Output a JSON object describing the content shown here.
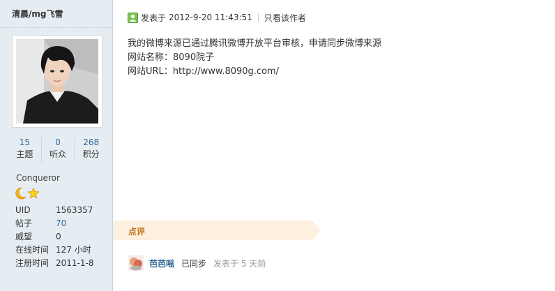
{
  "profile": {
    "username": "清晨/mg飞雪",
    "stats": [
      {
        "value": "15",
        "label": "主题"
      },
      {
        "value": "0",
        "label": "听众"
      },
      {
        "value": "268",
        "label": "积分"
      }
    ],
    "browser": "Conqueror",
    "info": [
      {
        "key": "UID",
        "value": "1563357"
      },
      {
        "key": "帖子",
        "value": "70"
      },
      {
        "key": "威望",
        "value": "0"
      },
      {
        "key": "在线时间",
        "value": "127 小时"
      },
      {
        "key": "注册时间",
        "value": "2011-1-8"
      }
    ]
  },
  "post": {
    "posted_label": "发表于",
    "date": "2012-9-20 11:43:51",
    "author_only": "只看该作者",
    "lines": [
      "我的微博来源已通过腾讯微博开放平台审核，申请同步微博来源",
      "网站名称：8090院子",
      "网站URL：http://www.8090g.com/"
    ]
  },
  "comments": {
    "section_label": "点评",
    "items": [
      {
        "user": "芭芭嗂",
        "text": "已同步",
        "time": "发表于 5 天前"
      }
    ]
  },
  "colors": {
    "sidebar_bg": "#e5edf2",
    "link": "#336699",
    "comment_bar": "#fdf0de",
    "comment_label": "#c06d18"
  }
}
